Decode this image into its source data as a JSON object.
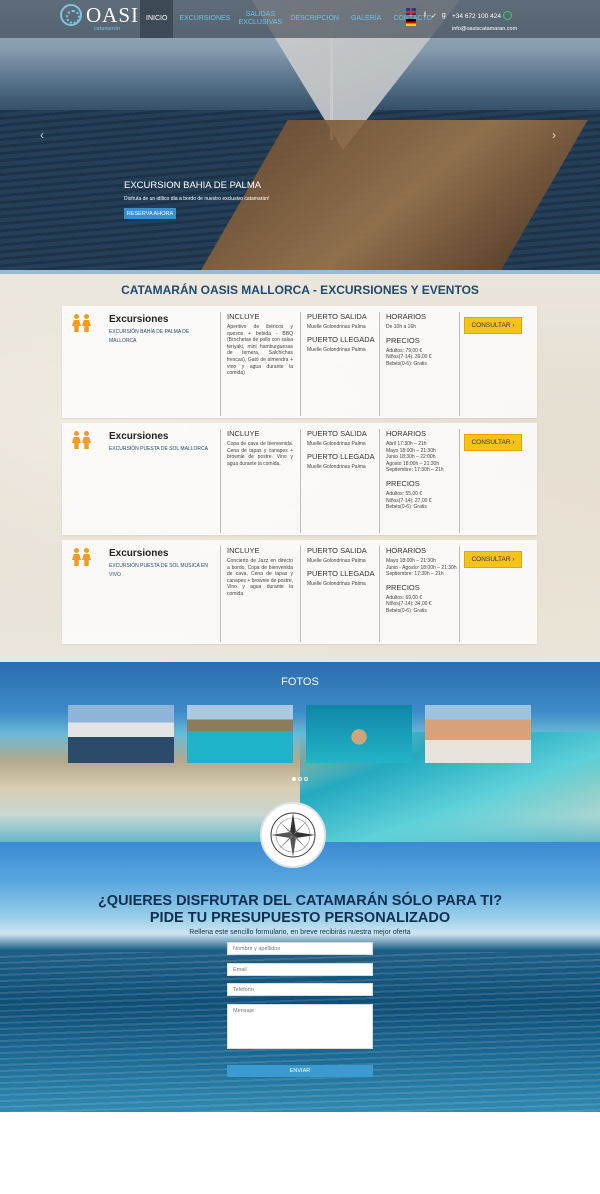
{
  "logo": {
    "name": "OASIS",
    "tagline": "catamarán"
  },
  "nav": [
    {
      "label": "INICIO",
      "active": true
    },
    {
      "label": "EXCURSIONES"
    },
    {
      "label": "SALIDAS EXCLUSIVAS"
    },
    {
      "label": "DESCRIPCIÓN"
    },
    {
      "label": "GALERÍA"
    },
    {
      "label": "CONTACTO"
    }
  ],
  "contact": {
    "phone": "+34 672 100 424",
    "email": "info@oasiscatamaran.com"
  },
  "social_icons": [
    "facebook-icon",
    "twitter-icon",
    "google-plus-icon",
    "whatsapp-icon"
  ],
  "hero": {
    "title": "EXCURSION BAHIA DE PALMA",
    "subtitle": "Disfruta de un idílico día a bordo de nuestro exclusivo catamarán!",
    "button": "RESERVA AHORA",
    "prev": "‹",
    "next": "›"
  },
  "section_title": "CATAMARÁN OASIS MALLORCA - EXCURSIONES Y EVENTOS",
  "labels": {
    "incluye": "INCLUYE",
    "puerto_salida": "PUERTO SALIDA",
    "puerto_llegada": "PUERTO LLEGADA",
    "horarios": "HORARIOS",
    "precios": "PRECIOS",
    "consultar": "CONSULTAR"
  },
  "excursions": [
    {
      "title": "Excursiones",
      "subtitle": "EXCURSIÓN BAHÍA DE PALMA DE MALLORCA",
      "incluye": "Aperitivo de ibéricos y quesos + bebida - BBQ (Brochetas de pollo con salsa teriyaki, mini hamburguesas de ternera, Salchichas frescas), Gató de almendra + vino y agua durante la comida)",
      "salida": "Muelle Golondrinas Palma",
      "llegada": "Muelle Golondrinas Palma",
      "horarios": [
        "De 10h a 16h"
      ],
      "precios": [
        "Adultos: 79,00 €",
        "Niños(7-14): 39,00 €",
        "Bebés(0-6): Gratis"
      ]
    },
    {
      "title": "Excursiones",
      "subtitle": "EXCURSIÓN PUESTA DE SOL MALLORCA",
      "incluye": "Copa de cava de bienvenida. Cena de tapas y canapes + brownie de postre. Vino y agua durante la comida.",
      "salida": "Muelle Golondrinas Palma",
      "llegada": "Muelle Golondrinas Palma",
      "horarios": [
        "Abril 17:30h – 21h",
        "Mayo 18:00h – 21:30h",
        "Junio 18:30h – 22:00h",
        "Agosto 18:00h – 21:30h",
        "Septiembre: 17:30h – 21h"
      ],
      "precios": [
        "Adultos: 55,00 €",
        "Niños(7-14): 27,00 €",
        "Bebés(0-6): Gratis"
      ]
    },
    {
      "title": "Excursiones",
      "subtitle": "EXCURSIÓN PUESTA DE SOL MUSICA EN VIVO",
      "incluye": "Concierto de Jazz en directo a bordo, Copa de bienvenida de cava, Cena de tapas y canapes + brownie de postre, Vino y agua durante la comida",
      "salida": "Muelle Golondrinas Palma",
      "llegada": "Muelle Golondrinas Palma",
      "horarios": [
        "Mayo 18:00h – 21:30h",
        "Junio - Agosto: 18:00h – 21:30h",
        "Septiembre: 17:30h – 21h"
      ],
      "precios": [
        "Adultos: 69,00 €",
        "Niños(7-14): 34,00 €",
        "Bebés(0-6): Gratis"
      ]
    }
  ],
  "fotos_title": "FOTOS",
  "cta": {
    "line1": "¿QUIERES DISFRUTAR DEL CATAMARÁN SÓLO PARA TI?",
    "line2": "PIDE TU PRESUPUESTO PERSONALIZADO",
    "line3": "Rellena este sencillo formulario, en breve recibirás nuestra mejor oferta"
  },
  "form": {
    "name_placeholder": "Nombre y apellidos",
    "email_placeholder": "Email",
    "phone_placeholder": "Teléfono",
    "message_placeholder": "Mensaje",
    "submit": "ENVIAR"
  },
  "colors": {
    "accent_blue": "#6cc2ea",
    "button_yellow": "#f6c31b",
    "title_blue": "#1e4a72",
    "person_orange": "#f39c1e"
  }
}
